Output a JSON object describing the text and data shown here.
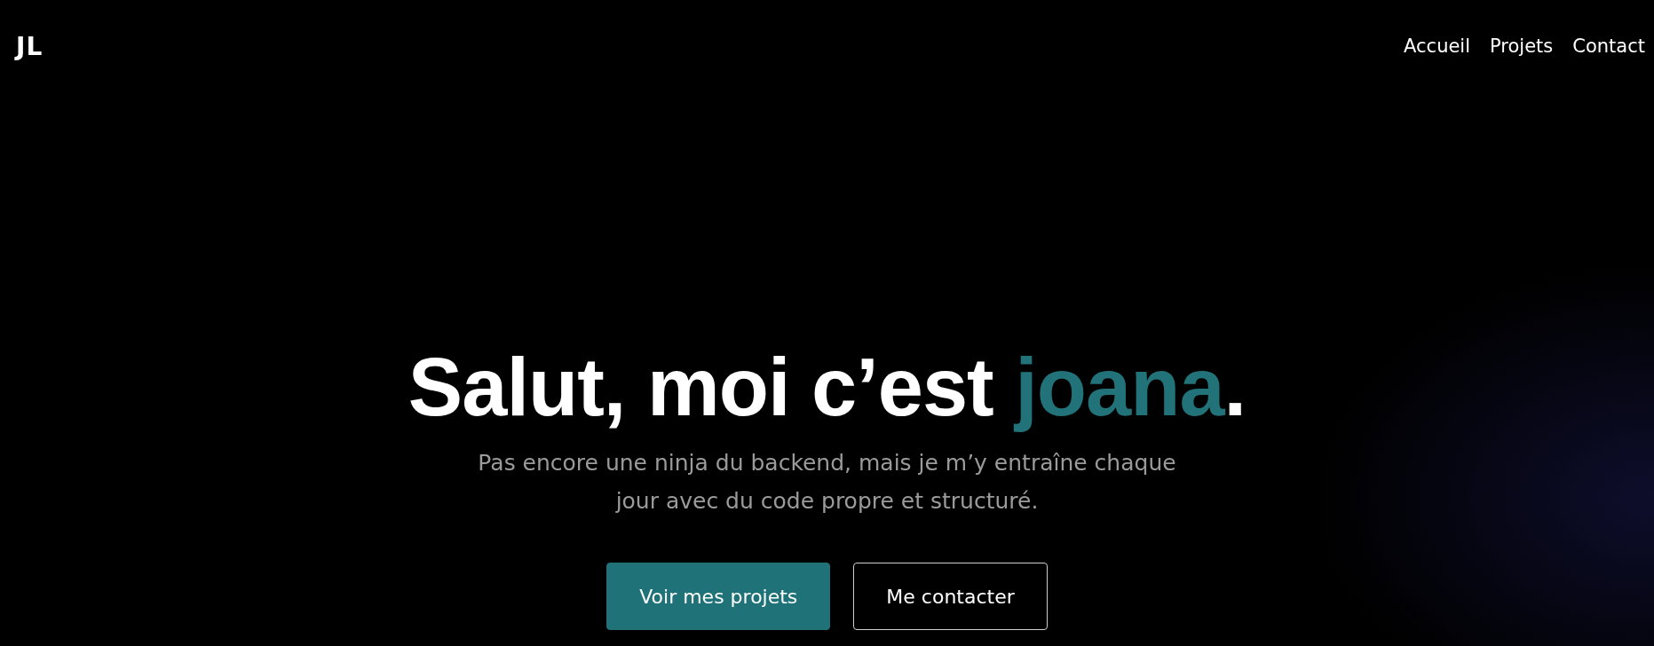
{
  "header": {
    "logo": "JL",
    "nav": [
      {
        "label": "Accueil"
      },
      {
        "label": "Projets"
      },
      {
        "label": "Contact"
      }
    ]
  },
  "hero": {
    "headline": [
      {
        "text": "Salut, moi c’est ",
        "accent": false
      },
      {
        "text": "joana",
        "accent": true
      },
      {
        "text": ".",
        "accent": false
      }
    ],
    "subtitle": "Pas encore une ninja du backend, mais je m’y entraîne chaque jour avec du code propre et structuré.",
    "buttons": [
      {
        "label": "Voir mes projets",
        "kind": "primary"
      },
      {
        "label": "Me contacter",
        "kind": "outline"
      }
    ]
  }
}
